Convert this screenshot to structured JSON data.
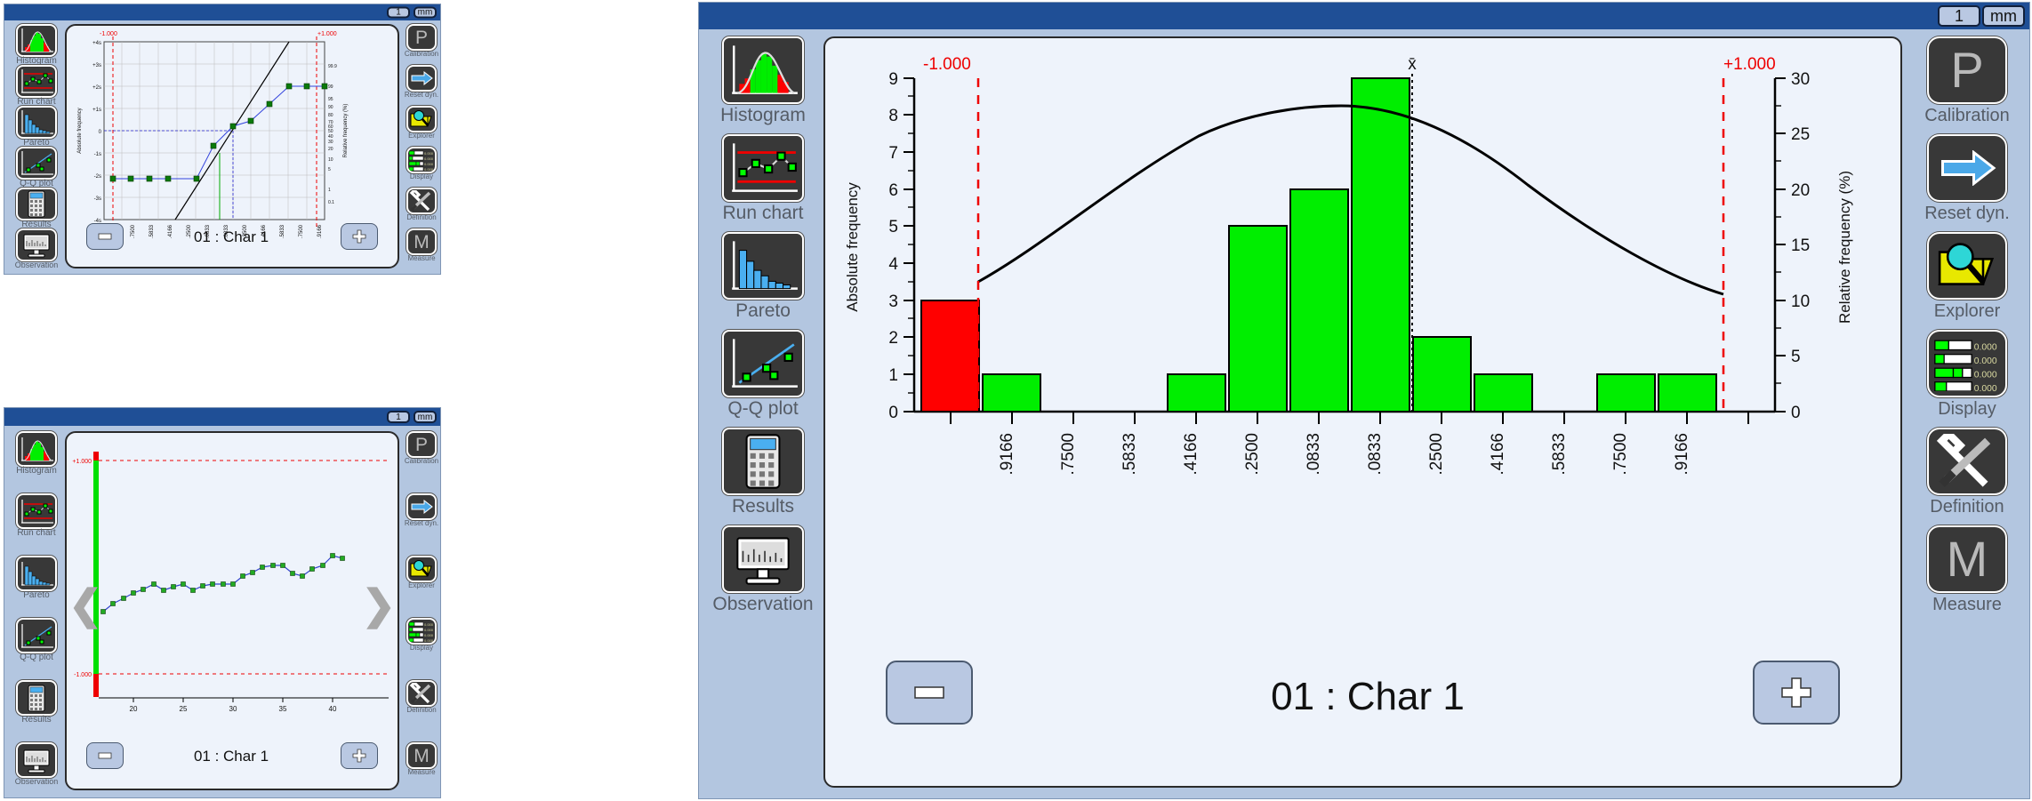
{
  "units": {
    "value": "1",
    "unit": "mm"
  },
  "sidebar_left": {
    "items": [
      {
        "label": "Histogram",
        "icon": "histogram-icon"
      },
      {
        "label": "Run chart",
        "icon": "runchart-icon"
      },
      {
        "label": "Pareto",
        "icon": "pareto-icon"
      },
      {
        "label": "Q-Q plot",
        "icon": "qqplot-icon"
      },
      {
        "label": "Results",
        "icon": "calculator-icon"
      },
      {
        "label": "Observation",
        "icon": "monitor-icon"
      }
    ]
  },
  "sidebar_right": {
    "items": [
      {
        "label": "Calibration",
        "icon": "letter-p-icon"
      },
      {
        "label": "Reset dyn.",
        "icon": "arrow-right-icon"
      },
      {
        "label": "Explorer",
        "icon": "magnifier-folder-icon"
      },
      {
        "label": "Display",
        "icon": "bargraph-rows-icon",
        "rows": [
          "0.000",
          "0.000",
          "0.000",
          "0.000"
        ]
      },
      {
        "label": "Definition",
        "icon": "wrench-screwdriver-icon"
      },
      {
        "label": "Measure",
        "icon": "letter-m-icon"
      }
    ]
  },
  "panels": {
    "qq": {
      "name": "Q-Q plot panel",
      "footer_title": "01 : Char 1",
      "minus_label": "–",
      "plus_label": "+"
    },
    "run": {
      "name": "Run chart panel",
      "footer_title": "01 : Char 1",
      "minus_label": "–",
      "plus_label": "+",
      "prev_label": "‹",
      "next_label": "›"
    },
    "histogram": {
      "name": "Histogram panel",
      "footer_title": "01 : Char 1",
      "minus_label": "–",
      "plus_label": "+"
    }
  },
  "chart_data": [
    {
      "id": "qq-plot",
      "type": "line",
      "title": "",
      "xlabel": "",
      "ylabel": "Absolute frequency",
      "y2label": "Relative frequency (%)",
      "limit_low_label": "-1.000",
      "limit_high_label": "+1.000",
      "yticks": [
        "+4s",
        "+3s",
        "+2s",
        "+1s",
        "0",
        "-1s",
        "-2s",
        "-3s",
        "-4s"
      ],
      "y2ticks": [
        "99.9",
        "99",
        "95",
        "90",
        "80",
        "70",
        "60",
        "50",
        "40",
        "30",
        "20",
        "10",
        "5",
        "1",
        "0.1"
      ],
      "xticks": [
        ".9166",
        ".7500",
        ".5833",
        ".4166",
        ".2500",
        ".0833",
        ".0833",
        ".2500",
        ".4166",
        ".5833",
        ".7500",
        ".9166"
      ],
      "points_sigma": [
        -2.2,
        -2.2,
        -2.2,
        -2.2,
        -2.2,
        -0.68,
        0.22,
        0.55,
        1.22,
        2.18,
        2.18,
        2.18
      ],
      "points_x": [
        0.5,
        1.5,
        2.5,
        3.5,
        4.5,
        5.5,
        6.5,
        7.5,
        8.5,
        9.5,
        10.5,
        11.5
      ],
      "reference_line": true,
      "mean_marker_x": 6.05,
      "median_marker_x": 6.9
    },
    {
      "id": "run-chart",
      "type": "line",
      "title": "",
      "xlabel": "",
      "ylabel": "",
      "limit_high_label": "+1.000",
      "limit_low_label": "-1.000",
      "xticks": [
        "20",
        "25",
        "30",
        "35",
        "40"
      ],
      "x": [
        17,
        18,
        19,
        20,
        21,
        22,
        23,
        24,
        25,
        26,
        27,
        28,
        29,
        30,
        31,
        32,
        33,
        34,
        35,
        36,
        37,
        38,
        39,
        40,
        41
      ],
      "values": [
        -0.42,
        -0.35,
        -0.28,
        -0.22,
        -0.18,
        -0.12,
        -0.22,
        -0.17,
        -0.12,
        -0.22,
        -0.14,
        -0.12,
        -0.12,
        -0.12,
        -0.04,
        0.0,
        0.06,
        0.08,
        0.08,
        0.01,
        -0.02,
        0.05,
        0.08,
        0.17,
        0.15
      ],
      "ylim": [
        -1.0,
        1.0
      ]
    },
    {
      "id": "histogram",
      "type": "bar",
      "title": "",
      "xlabel": "",
      "ylabel": "Absolute frequency",
      "y2label": "Relative frequency (%)",
      "limit_low_label": "-1.000",
      "limit_high_label": "+1.000",
      "mean_label": "x̄",
      "yticks": [
        9,
        8,
        7,
        6,
        5,
        4,
        3,
        2,
        1,
        0
      ],
      "ylim": [
        0,
        9
      ],
      "y2ticks": [
        30,
        25,
        20,
        15,
        10,
        5,
        0
      ],
      "y2lim": [
        0,
        30
      ],
      "categories": [
        ".9166",
        ".7500",
        ".5833",
        ".4166",
        ".2500",
        ".0833",
        ".0833",
        ".2500",
        ".4166",
        ".5833",
        ".7500",
        ".9166"
      ],
      "values": [
        3,
        1,
        0,
        0,
        1,
        5,
        6,
        9,
        2,
        1,
        0,
        1,
        1
      ],
      "bar_colors": [
        "#ff0000",
        "#00ee00",
        "none",
        "none",
        "#00ee00",
        "#00ee00",
        "#00ee00",
        "#00ee00",
        "#00ee00",
        "#00ee00",
        "none",
        "#00ee00",
        "#00ee00"
      ],
      "curve": "normal distribution overlay",
      "curve_peak": 8.05,
      "legend": []
    }
  ]
}
